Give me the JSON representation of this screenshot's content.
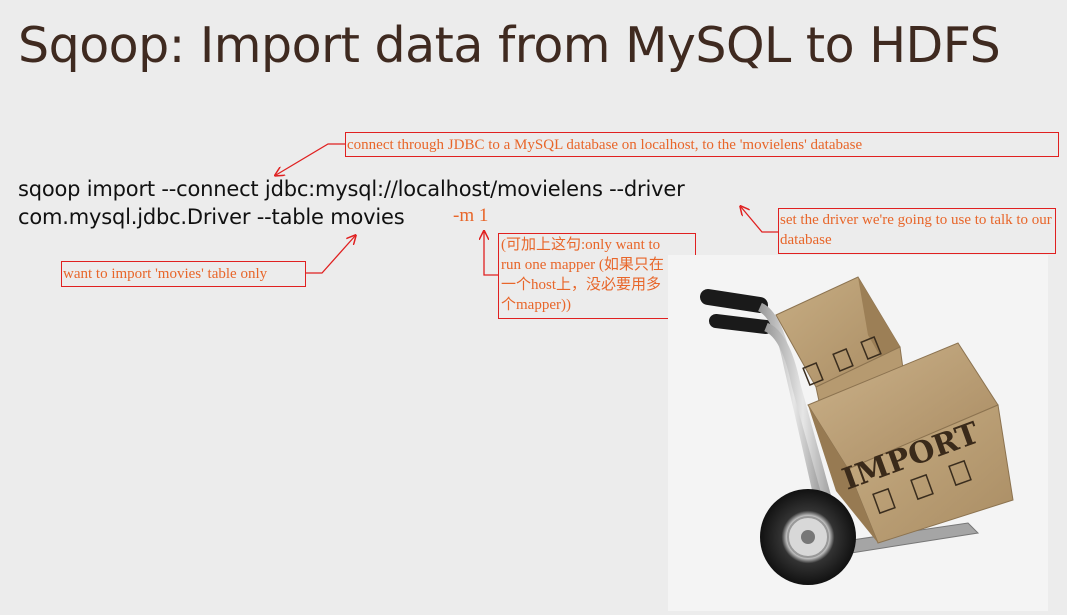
{
  "slide": {
    "title": "Sqoop: Import data from MySQL to HDFS",
    "command_line1": "sqoop import --connect jdbc:mysql://localhost/movielens --driver",
    "command_line2": "com.mysql.jdbc.Driver --table movies",
    "command_option": "-m 1"
  },
  "annotations": {
    "connect": "connect through JDBC to a MySQL database on localhost, to the 'movielens' database",
    "driver": "set the driver we're going to use to talk to our database",
    "table": "want to import 'movies' table only",
    "mapper_lines": [
      "(可加上这句:only want to",
      "run one mapper (如果只在",
      "一个host上，没必要用多",
      "个mapper))"
    ]
  },
  "image": {
    "label": "IMPORT",
    "icon": "hand-truck-with-boxes-illustration"
  },
  "colors": {
    "title": "#3f2a20",
    "annotation_text": "#e8662a",
    "annotation_border": "#e02020",
    "background": "#ececec"
  }
}
